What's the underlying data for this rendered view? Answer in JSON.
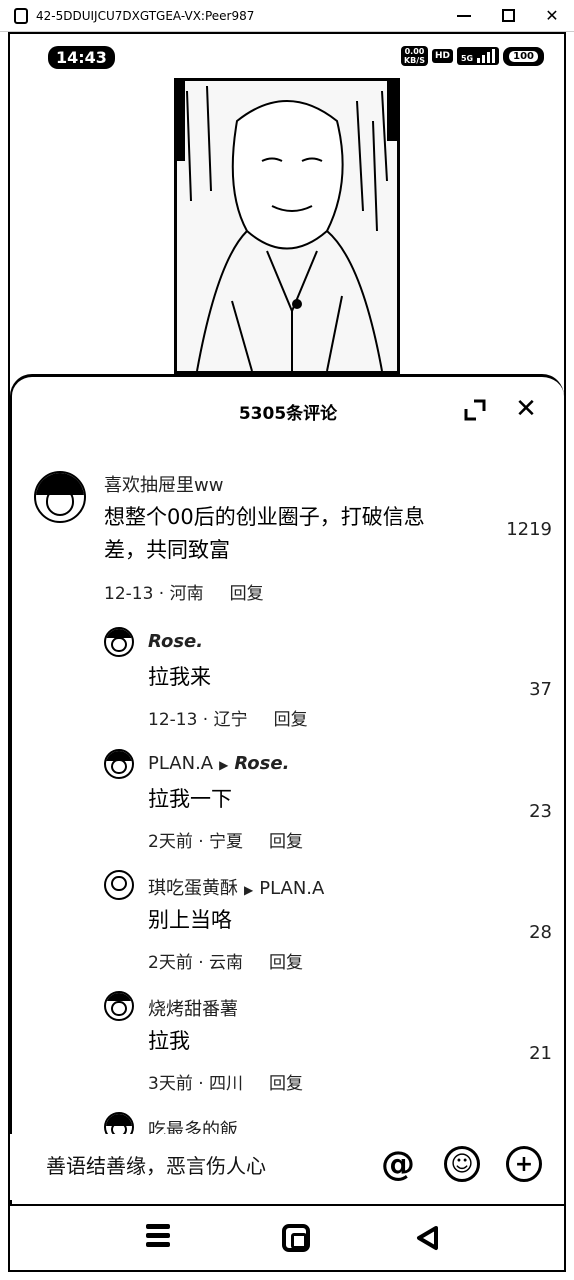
{
  "window": {
    "title": "42-5DDUIJCU7DXGTGEA-VX:Peer987",
    "minimize": "minimize",
    "maximize": "maximize",
    "close": "✕"
  },
  "status_bar": {
    "time": "14:43",
    "net_speed_top": "0.00",
    "net_speed_bottom": "KB/S",
    "hd": "HD",
    "signal": "5G",
    "battery": "100"
  },
  "comments_panel": {
    "title": "5305条评论",
    "expand_icon": "expand-icon",
    "close_label": "✕"
  },
  "comments": [
    {
      "user": "喜欢抽屉里ww",
      "text_line1": "想整个00后的创业圈子，打破信息",
      "text_line2": "差，共同致富",
      "date": "12-13 · 河南",
      "reply": "回复",
      "likes": "1219"
    }
  ],
  "replies": [
    {
      "user": "Rose.",
      "reply_to": "",
      "text": "拉我来",
      "date": "12-13 · 辽宁",
      "reply": "回复",
      "likes": "37"
    },
    {
      "user": "PLAN.A",
      "reply_to": "Rose.",
      "text": "拉我一下",
      "date": "2天前 · 宁夏",
      "reply": "回复",
      "likes": "23"
    },
    {
      "user": "琪吃蛋黄酥",
      "reply_to": "PLAN.A",
      "text": "别上当咯",
      "date": "2天前 · 云南",
      "reply": "回复",
      "likes": "28"
    },
    {
      "user": "烧烤甜番薯",
      "reply_to": "",
      "text": "拉我",
      "date": "3天前 · 四川",
      "reply": "回复",
      "likes": "21"
    },
    {
      "user": "吃最多的飯",
      "reply_to": "",
      "text": "",
      "date": "",
      "reply": "",
      "likes": ""
    }
  ],
  "input_bar": {
    "placeholder": "善语结善缘，恶言伤人心",
    "at": "@",
    "emoji": "☺",
    "plus": "+"
  },
  "nav_bar": {
    "menu_icon": "menu-icon",
    "home_icon": "home-icon",
    "back_icon": "back-icon"
  }
}
